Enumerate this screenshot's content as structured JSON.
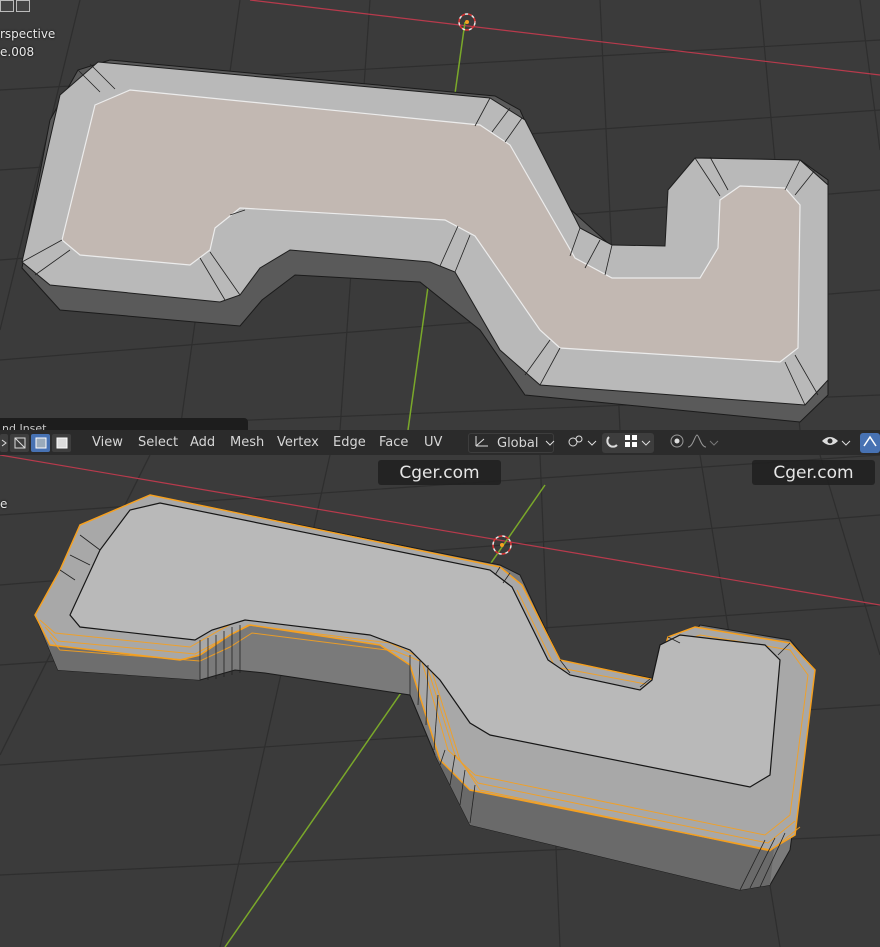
{
  "top_viewport": {
    "view_label": "rspective",
    "object_label": "e.008"
  },
  "operator_panel": {
    "label": "nd Inset"
  },
  "header": {
    "menus": [
      "View",
      "Select",
      "Add",
      "Mesh",
      "Vertex",
      "Edge",
      "Face",
      "UV"
    ],
    "orientation": "Global"
  },
  "bottom_viewport": {
    "view_label": "e"
  },
  "watermarks": [
    "Cger.com",
    "Cger.com"
  ],
  "colors": {
    "viewport_bg": "#3b3b3b",
    "header_bg": "#2b2b2b",
    "active_blue": "#4772b3",
    "selection_orange": "#f5a020",
    "x_axis": "#b83a4c",
    "y_axis": "#7aa82a"
  },
  "icons": [
    "select-box-icon",
    "vertex-select-icon",
    "edge-select-icon",
    "face-select-icon",
    "transform-orientation-icon",
    "pivot-icon",
    "snap-icon",
    "snap-target-icon",
    "proportional-edit-icon",
    "falloff-icon",
    "visibility-icon",
    "gizmo-icon",
    "3d-cursor-icon"
  ]
}
